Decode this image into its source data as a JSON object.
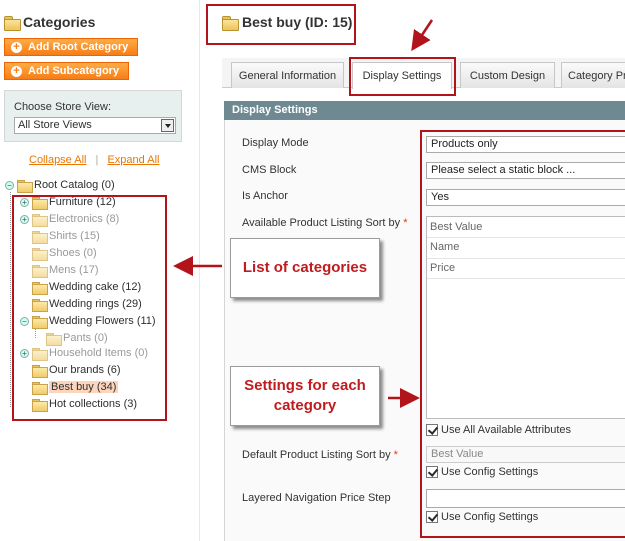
{
  "sidebar": {
    "title": "Categories",
    "add_root_label": "Add Root Category",
    "add_sub_label": "Add Subcategory",
    "store_view_label": "Choose Store View:",
    "store_view_value": "All Store Views",
    "collapse_all": "Collapse All",
    "separator": "|",
    "expand_all": "Expand All",
    "tree": [
      {
        "label": "Root Catalog (0)"
      },
      {
        "label": "Furniture (12)"
      },
      {
        "label": "Electronics (8)"
      },
      {
        "label": "Shirts (15)"
      },
      {
        "label": "Shoes (0)"
      },
      {
        "label": "Mens (17)"
      },
      {
        "label": "Wedding cake (12)"
      },
      {
        "label": "Wedding rings (29)"
      },
      {
        "label": "Wedding Flowers (11)"
      },
      {
        "label": "Pants (0)"
      },
      {
        "label": "Household Items (0)"
      },
      {
        "label": "Our brands (6)"
      },
      {
        "label": "Best buy (34)"
      },
      {
        "label": "Hot collections (3)"
      }
    ]
  },
  "main": {
    "title": "Best buy (ID: 15)",
    "tabs": [
      {
        "label": "General Information"
      },
      {
        "label": "Display Settings"
      },
      {
        "label": "Custom Design"
      },
      {
        "label": "Category Pr"
      }
    ],
    "section_title": "Display Settings",
    "fields": {
      "display_mode_label": "Display Mode",
      "display_mode_value": "Products only",
      "cms_block_label": "CMS Block",
      "cms_block_value": "Please select a static block ...",
      "is_anchor_label": "Is Anchor",
      "is_anchor_value": "Yes",
      "sort_by_label": "Available Product Listing Sort by",
      "required_mark": "*",
      "sort_options": [
        "Best Value",
        "Name",
        "Price"
      ],
      "use_all_label": "Use All Available Attributes",
      "default_sort_label": "Default Product Listing Sort by",
      "default_sort_value": "Best Value",
      "use_config_label_1": "Use Config Settings",
      "price_step_label": "Layered Navigation Price Step",
      "price_step_value": "",
      "use_config_label_2": "Use Config Settings"
    }
  },
  "annotations": {
    "list_callout": "List of categories",
    "settings_callout": "Settings for each category",
    "accent_color": "#b1141b"
  }
}
